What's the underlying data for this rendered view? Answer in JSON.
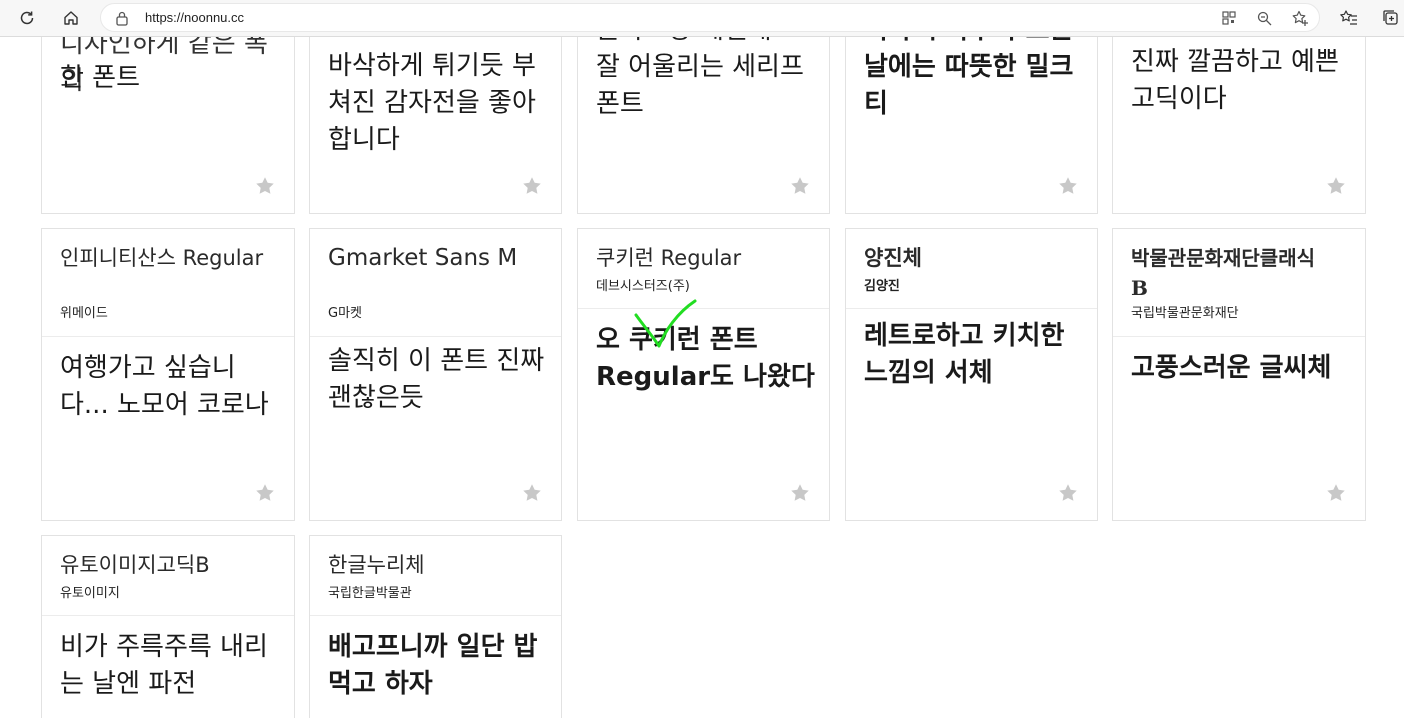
{
  "browser": {
    "url": "https://noonnu.cc"
  },
  "top_row": [
    {
      "sample": "한 폰트",
      "clipped_line": "디자인하게 같은 폭의"
    },
    {
      "sample": "바삭하게 튀기듯 부쳐진 감자전을 좋아합니다"
    },
    {
      "sample": "잘 어울리는 세리프 폰트",
      "clipped_line": "글자모양 세밀해"
    },
    {
      "sample": "날에는 따뜻한 밀크티",
      "clipped_line": "비가 주룩주룩 오는"
    },
    {
      "sample": "진짜 깔끔하고 예쁜 고딕이다"
    }
  ],
  "middle_row": [
    {
      "name": "인피니티산스 Regular",
      "maker": "위메이드",
      "sample": "여행가고 싶습니다... 노모어 코로나"
    },
    {
      "name": "Gmarket Sans M",
      "maker": "G마켓",
      "sample": "솔직히 이 폰트 진짜 괜찮은듯"
    },
    {
      "name": "쿠키런 Regular",
      "maker": "데브시스터즈(주)",
      "sample": "오 쿠키런 폰트 Regular도 나왔다"
    },
    {
      "name": "양진체",
      "maker": "김양진",
      "sample": "레트로하고 키치한 느낌의 서체"
    },
    {
      "name": "박물관문화재단클래식B",
      "maker": "국립박물관문화재단",
      "sample": "고풍스러운 글씨체"
    }
  ],
  "bottom_row": [
    {
      "name": "유토이미지고딕B",
      "maker": "유토이미지",
      "sample": "비가 주륵주륵 내리는 날엔 파전"
    },
    {
      "name": "한글누리체",
      "maker": "국립한글박물관",
      "sample": "배고프니까 일단 밥먹고 하자"
    }
  ],
  "icons": {
    "reload": "reload-icon",
    "home": "home-icon",
    "lock": "lock-icon",
    "star": "star-icon"
  },
  "colors": {
    "star": "#c8c8c8",
    "check_mark": "#22dd22",
    "border": "#e2e2e2"
  }
}
